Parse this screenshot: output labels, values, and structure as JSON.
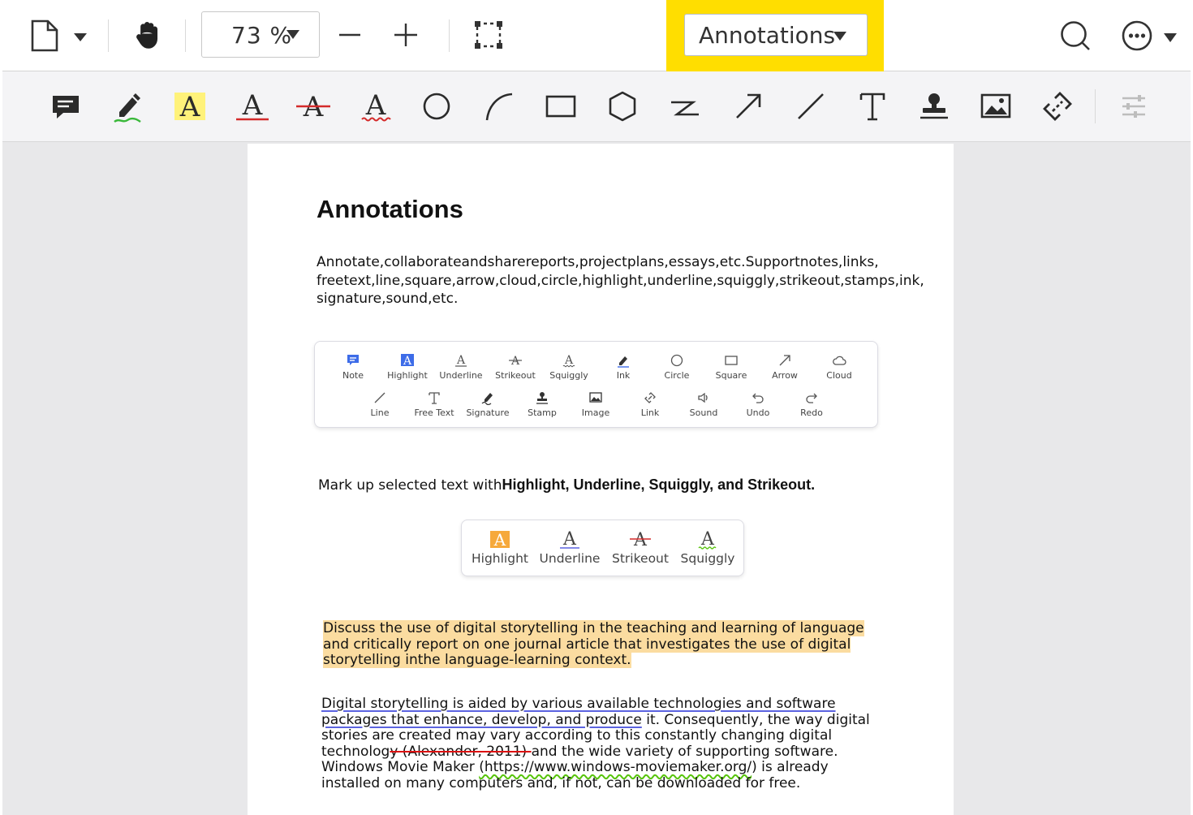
{
  "toolbar": {
    "zoom_value": "73 %",
    "mode_label": "Annotations"
  },
  "annotation_tools": [
    "comment-icon",
    "ink-pen-icon",
    "highlight-text-icon",
    "underline-text-icon",
    "strikeout-text-icon",
    "squiggly-text-icon",
    "circle-icon",
    "arc-icon",
    "rectangle-icon",
    "polygon-icon",
    "polyline-icon",
    "arrow-icon",
    "line-icon",
    "free-text-icon",
    "stamp-icon",
    "image-icon",
    "link-icon",
    "settings-sliders-icon"
  ],
  "document": {
    "title": "Annotations",
    "intro": "Annotate,collaborateandsharereports,projectplans,essays,etc.Supportnotes,links, freetext,line,square,arrow,cloud,circle,highlight,underline,squiggly,strikeout,stamps,ink, signature,sound,etc.",
    "panel_row1": [
      "Note",
      "Highlight",
      "Underline",
      "Strikeout",
      "Squiggly",
      "Ink",
      "Circle",
      "Square",
      "Arrow",
      "Cloud"
    ],
    "panel_row2": [
      "Line",
      "Free Text",
      "Signature",
      "Stamp",
      "Image",
      "Link",
      "Sound",
      "Undo",
      "Redo"
    ],
    "markup_prefix": "Mark up selected text with",
    "markup_bold": "Highlight, Underline, Squiggly, and Strikeout.",
    "popup_items": [
      "Highlight",
      "Underline",
      "Strikeout",
      "Squiggly"
    ],
    "para1": "Discuss the use of digital storytelling in the teaching and learning of language and critically report on one journal article that investigates the use of digital storytelling inthe language-learning context.",
    "para2": {
      "underlined": "Digital storytelling is aided by various available technologies and software packages that enhance, develop, and produce",
      "text_a": " it. Consequently, the way digital stories are created may vary according to this constantly changing digital technolog",
      "strike": "y (Alexander, 2011) ",
      "text_b": "and the wide variety of supporting software. Windows Movie Maker ",
      "squiggly": "(https://www.windows-moviemaker.org/",
      "text_c": ") is already installed on many computers and, if not, can be downloaded for free."
    }
  }
}
